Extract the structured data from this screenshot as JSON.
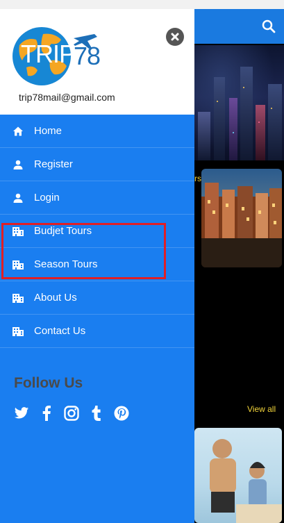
{
  "drawer": {
    "logo_text": "TRIP",
    "logo_number": "78",
    "email": "trip78mail@gmail.com",
    "menu": [
      {
        "label": "Home",
        "icon": "home-icon"
      },
      {
        "label": "Register",
        "icon": "person-icon"
      },
      {
        "label": "Login",
        "icon": "person-icon"
      },
      {
        "label": "Budjet Tours",
        "icon": "building-icon"
      },
      {
        "label": "Season Tours",
        "icon": "building-icon"
      },
      {
        "label": "About Us",
        "icon": "building-icon"
      },
      {
        "label": "Contact Us",
        "icon": "building-icon"
      }
    ],
    "follow_title": "Follow Us",
    "social": [
      "twitter-icon",
      "facebook-icon",
      "instagram-icon",
      "tumblr-icon",
      "pinterest-icon"
    ]
  },
  "background": {
    "card1_label": "rs",
    "view_all": "View all"
  },
  "colors": {
    "drawer_blue": "#1a7ef0",
    "appbar_blue": "#1a7ae0",
    "highlight_red": "#e01f26",
    "accent_yellow": "#f1d33a"
  }
}
